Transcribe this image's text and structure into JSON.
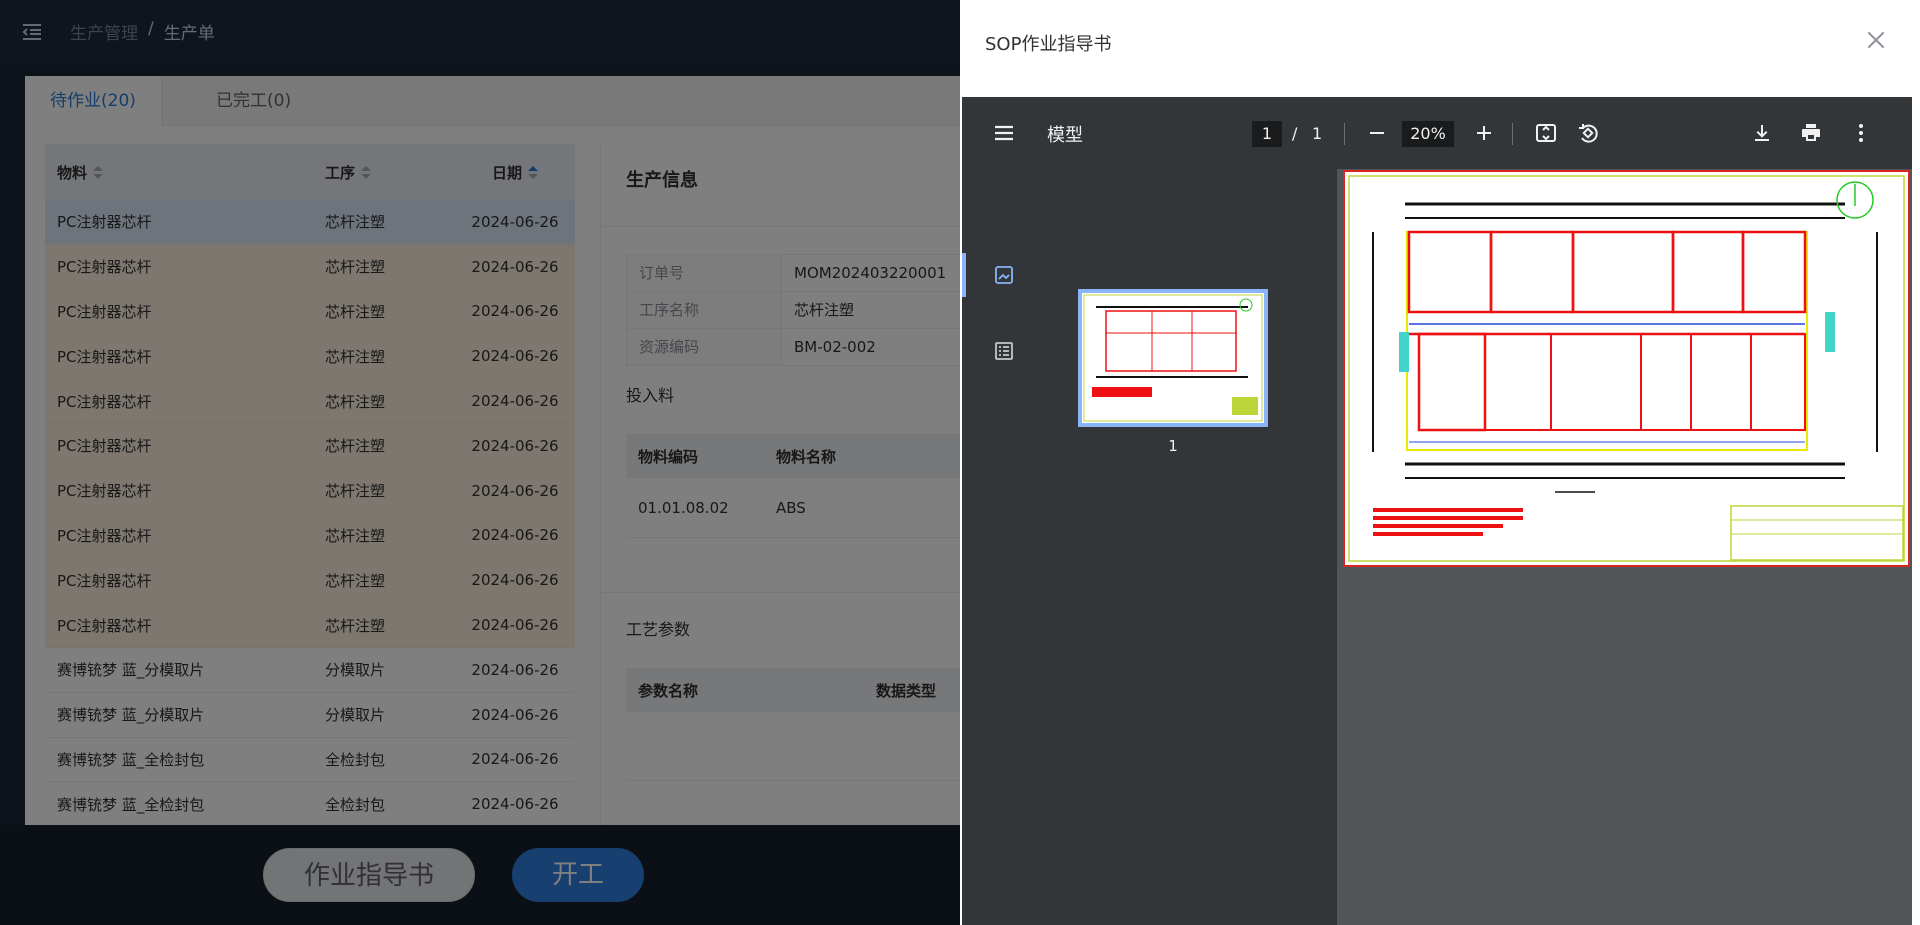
{
  "app": {
    "breadcrumb": {
      "parent": "生产管理",
      "separator": "/",
      "current": "生产单"
    },
    "tabs": [
      {
        "label": "待作业(20)"
      },
      {
        "label": "已完工(0)"
      }
    ],
    "list": {
      "headers": {
        "material": "物料",
        "process": "工序",
        "date": "日期"
      },
      "rows": [
        {
          "material": "PC注射器芯杆",
          "process": "芯杆注塑",
          "date": "2024-06-26"
        },
        {
          "material": "PC注射器芯杆",
          "process": "芯杆注塑",
          "date": "2024-06-26"
        },
        {
          "material": "PC注射器芯杆",
          "process": "芯杆注塑",
          "date": "2024-06-26"
        },
        {
          "material": "PC注射器芯杆",
          "process": "芯杆注塑",
          "date": "2024-06-26"
        },
        {
          "material": "PC注射器芯杆",
          "process": "芯杆注塑",
          "date": "2024-06-26"
        },
        {
          "material": "PC注射器芯杆",
          "process": "芯杆注塑",
          "date": "2024-06-26"
        },
        {
          "material": "PC注射器芯杆",
          "process": "芯杆注塑",
          "date": "2024-06-26"
        },
        {
          "material": "PC注射器芯杆",
          "process": "芯杆注塑",
          "date": "2024-06-26"
        },
        {
          "material": "PC注射器芯杆",
          "process": "芯杆注塑",
          "date": "2024-06-26"
        },
        {
          "material": "PC注射器芯杆",
          "process": "芯杆注塑",
          "date": "2024-06-26"
        },
        {
          "material": "赛博铳梦 蓝_分模取片",
          "process": "分模取片",
          "date": "2024-06-26"
        },
        {
          "material": "赛博铳梦 蓝_分模取片",
          "process": "分模取片",
          "date": "2024-06-26"
        },
        {
          "material": "赛博铳梦 蓝_全检封包",
          "process": "全检封包",
          "date": "2024-06-26"
        },
        {
          "material": "赛博铳梦 蓝_全检封包",
          "process": "全检封包",
          "date": "2024-06-26"
        }
      ]
    },
    "info": {
      "title": "生产信息",
      "fields": [
        {
          "label": "订单号",
          "value": "MOM202403220001"
        },
        {
          "label": "工序名称",
          "value": "芯杆注塑"
        },
        {
          "label": "资源编码",
          "value": "BM-02-002"
        }
      ],
      "input_section": "投入料",
      "input_headers": {
        "code": "物料编码",
        "name": "物料名称"
      },
      "input_rows": [
        {
          "code": "01.01.08.02",
          "name": "ABS"
        }
      ],
      "param_section": "工艺参数",
      "param_headers": {
        "name": "参数名称",
        "type": "数据类型"
      }
    },
    "footer": {
      "guide_button": "作业指导书",
      "start_button": "开工"
    }
  },
  "drawer": {
    "title": "SOP作业指导书",
    "viewer": {
      "doc_title": "模型",
      "current_page": "1",
      "page_separator": "/",
      "total_pages": "1",
      "zoom": "20%",
      "thumbnail_label": "1"
    }
  },
  "colors": {
    "accent": "#2b7bd6",
    "start_button": "#2e7fde",
    "viewer_toolbar": "#323639",
    "viewer_bg": "#525659",
    "thumb_border": "#8ab4f8"
  },
  "icons": {
    "menu_toggle": "menu-fold-icon",
    "close": "close-icon",
    "viewer_menu": "hamburger-icon",
    "zoom_out": "minus-icon",
    "zoom_in": "plus-icon",
    "fit": "fit-page-icon",
    "rotate": "rotate-icon",
    "download": "download-icon",
    "print": "print-icon",
    "more": "more-vert-icon",
    "thumbnails": "image-icon",
    "outline": "outline-list-icon"
  }
}
